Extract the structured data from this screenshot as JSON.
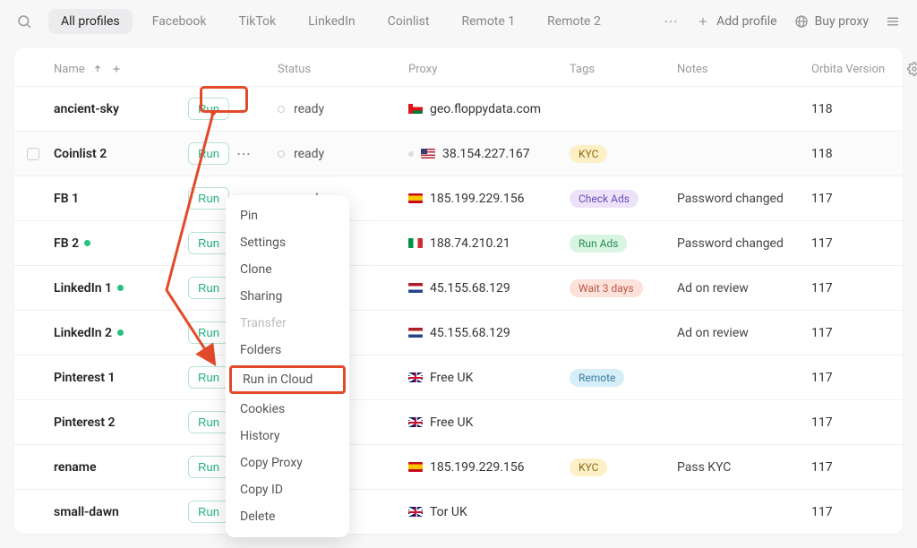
{
  "topbar": {
    "tabs": [
      {
        "label": "All profiles",
        "active": true
      },
      {
        "label": "Facebook"
      },
      {
        "label": "TikTok"
      },
      {
        "label": "LinkedIn"
      },
      {
        "label": "Coinlist"
      },
      {
        "label": "Remote 1"
      },
      {
        "label": "Remote 2"
      }
    ],
    "add_profile_label": "Add profile",
    "buy_proxy_label": "Buy proxy"
  },
  "columns": {
    "name": "Name",
    "status": "Status",
    "proxy": "Proxy",
    "tags": "Tags",
    "notes": "Notes",
    "version": "Orbita Version"
  },
  "run_label": "Run",
  "status_ready": "ready",
  "rows": [
    {
      "name": "ancient-sky",
      "proxy": "geo.floppydata.com",
      "flag": "om",
      "tag": null,
      "notes": "",
      "version": "118",
      "run_highlight": true,
      "has_greendot": false
    },
    {
      "name": "Coinlist 2",
      "proxy": "38.154.227.167",
      "flag": "us",
      "dim": true,
      "tag": {
        "text": "KYC",
        "cls": "tag-yellow"
      },
      "notes": "",
      "version": "118",
      "highlight": true,
      "show_checkbox": true,
      "show_dots": true
    },
    {
      "name": "FB 1",
      "proxy": "185.199.229.156",
      "flag": "es",
      "tag": {
        "text": "Check Ads",
        "cls": "tag-violet"
      },
      "notes": "Password changed",
      "version": "117"
    },
    {
      "name": "FB 2",
      "proxy": "188.74.210.21",
      "flag": "it",
      "tag": {
        "text": "Run Ads",
        "cls": "tag-green"
      },
      "notes": "Password changed",
      "version": "117",
      "has_greendot": true
    },
    {
      "name": "LinkedIn 1",
      "proxy": "45.155.68.129",
      "flag": "nl",
      "tag": {
        "text": "Wait 3 days",
        "cls": "tag-red"
      },
      "notes": "Ad on review",
      "version": "117",
      "has_greendot": true
    },
    {
      "name": "LinkedIn 2",
      "proxy": "45.155.68.129",
      "flag": "nl",
      "tag": null,
      "notes": "Ad on review",
      "version": "117",
      "has_greendot": true
    },
    {
      "name": "Pinterest 1",
      "proxy": "Free UK",
      "flag": "gb",
      "tag": {
        "text": "Remote",
        "cls": "tag-blue"
      },
      "notes": "",
      "version": "117"
    },
    {
      "name": "Pinterest 2",
      "proxy": "Free UK",
      "flag": "gb",
      "tag": null,
      "notes": "",
      "version": "117"
    },
    {
      "name": "rename",
      "proxy": "185.199.229.156",
      "flag": "es",
      "tag": {
        "text": "KYC",
        "cls": "tag-yellow"
      },
      "notes": "Pass KYC",
      "version": "117"
    },
    {
      "name": "small-dawn",
      "proxy": "Tor UK",
      "flag": "gb",
      "tag": null,
      "notes": "",
      "version": "117"
    }
  ],
  "context_menu": [
    {
      "label": "Pin"
    },
    {
      "label": "Settings"
    },
    {
      "label": "Clone"
    },
    {
      "label": "Sharing"
    },
    {
      "label": "Transfer",
      "muted": true
    },
    {
      "label": "Folders"
    },
    {
      "label": "Run in Cloud",
      "highlight": true
    },
    {
      "label": "Cookies"
    },
    {
      "label": "History"
    },
    {
      "label": "Copy Proxy"
    },
    {
      "label": "Copy ID"
    },
    {
      "label": "Delete"
    }
  ]
}
